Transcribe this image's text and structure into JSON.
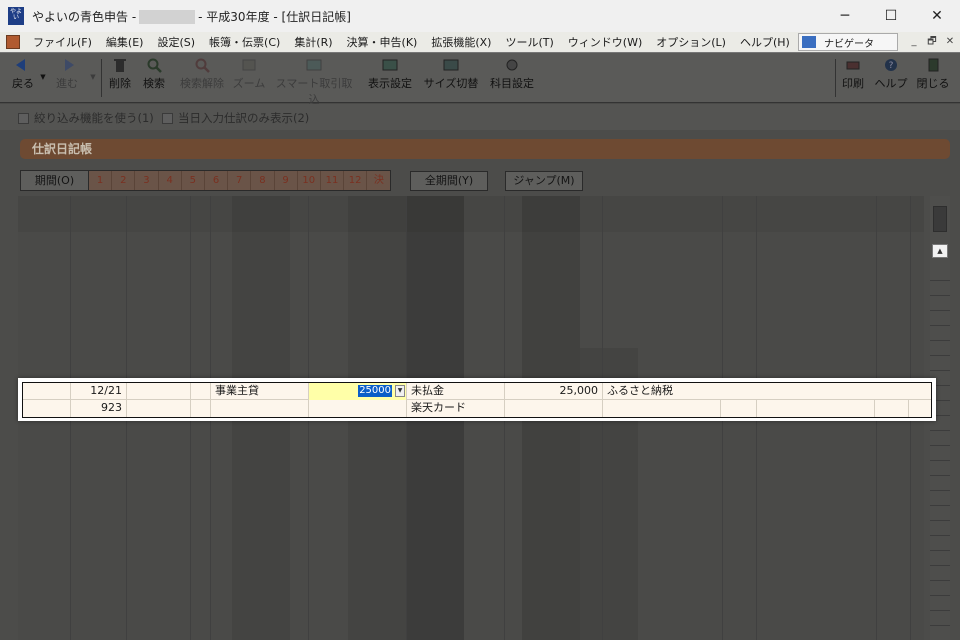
{
  "window": {
    "app_icon_text": "やよい",
    "title_prefix": "やよいの青色申告 -",
    "title_suffix": "- 平成30年度 - [仕訳日記帳]",
    "minimize": "─",
    "maximize": "☐",
    "close": "✕"
  },
  "menu": {
    "items": [
      "ファイル(F)",
      "編集(E)",
      "設定(S)",
      "帳簿・伝票(C)",
      "集計(R)",
      "決算・申告(K)",
      "拡張機能(X)",
      "ツール(T)",
      "ウィンドウ(W)",
      "オプション(L)",
      "ヘルプ(H)"
    ],
    "navigator_label": "ナビゲータ",
    "mdi_minimize": "_",
    "mdi_restore": "🗗",
    "mdi_close": "✕"
  },
  "toolbar": {
    "back": "戻る",
    "forward": "進む",
    "delete": "削除",
    "search": "検索",
    "search_clear": "検索解除",
    "zoom": "ズーム",
    "smart_entry": "スマート取引取込",
    "display_settings": "表示設定",
    "size_toggle": "サイズ切替",
    "account_settings": "科目設定",
    "print": "印刷",
    "help": "ヘルプ",
    "close": "閉じる"
  },
  "options": {
    "filter_label": "絞り込み機能を使う(1)",
    "today_label": "当日入力仕訳のみ表示(2)"
  },
  "journal": {
    "tab_title": "仕訳日記帳",
    "period_label": "期間(O)",
    "months": [
      "1",
      "2",
      "3",
      "4",
      "5",
      "6",
      "7",
      "8",
      "9",
      "10",
      "11",
      "12",
      "決"
    ],
    "all_period_label": "全期間(Y)",
    "jump_label": "ジャンプ(M)"
  },
  "entry": {
    "date": "12/21",
    "number": "923",
    "debit_account": "事業主貸",
    "debit_amount": "25000",
    "credit_account": "未払金",
    "credit_sub_account": "楽天カード",
    "credit_amount": "25,000",
    "memo": "ふるさと納税"
  }
}
